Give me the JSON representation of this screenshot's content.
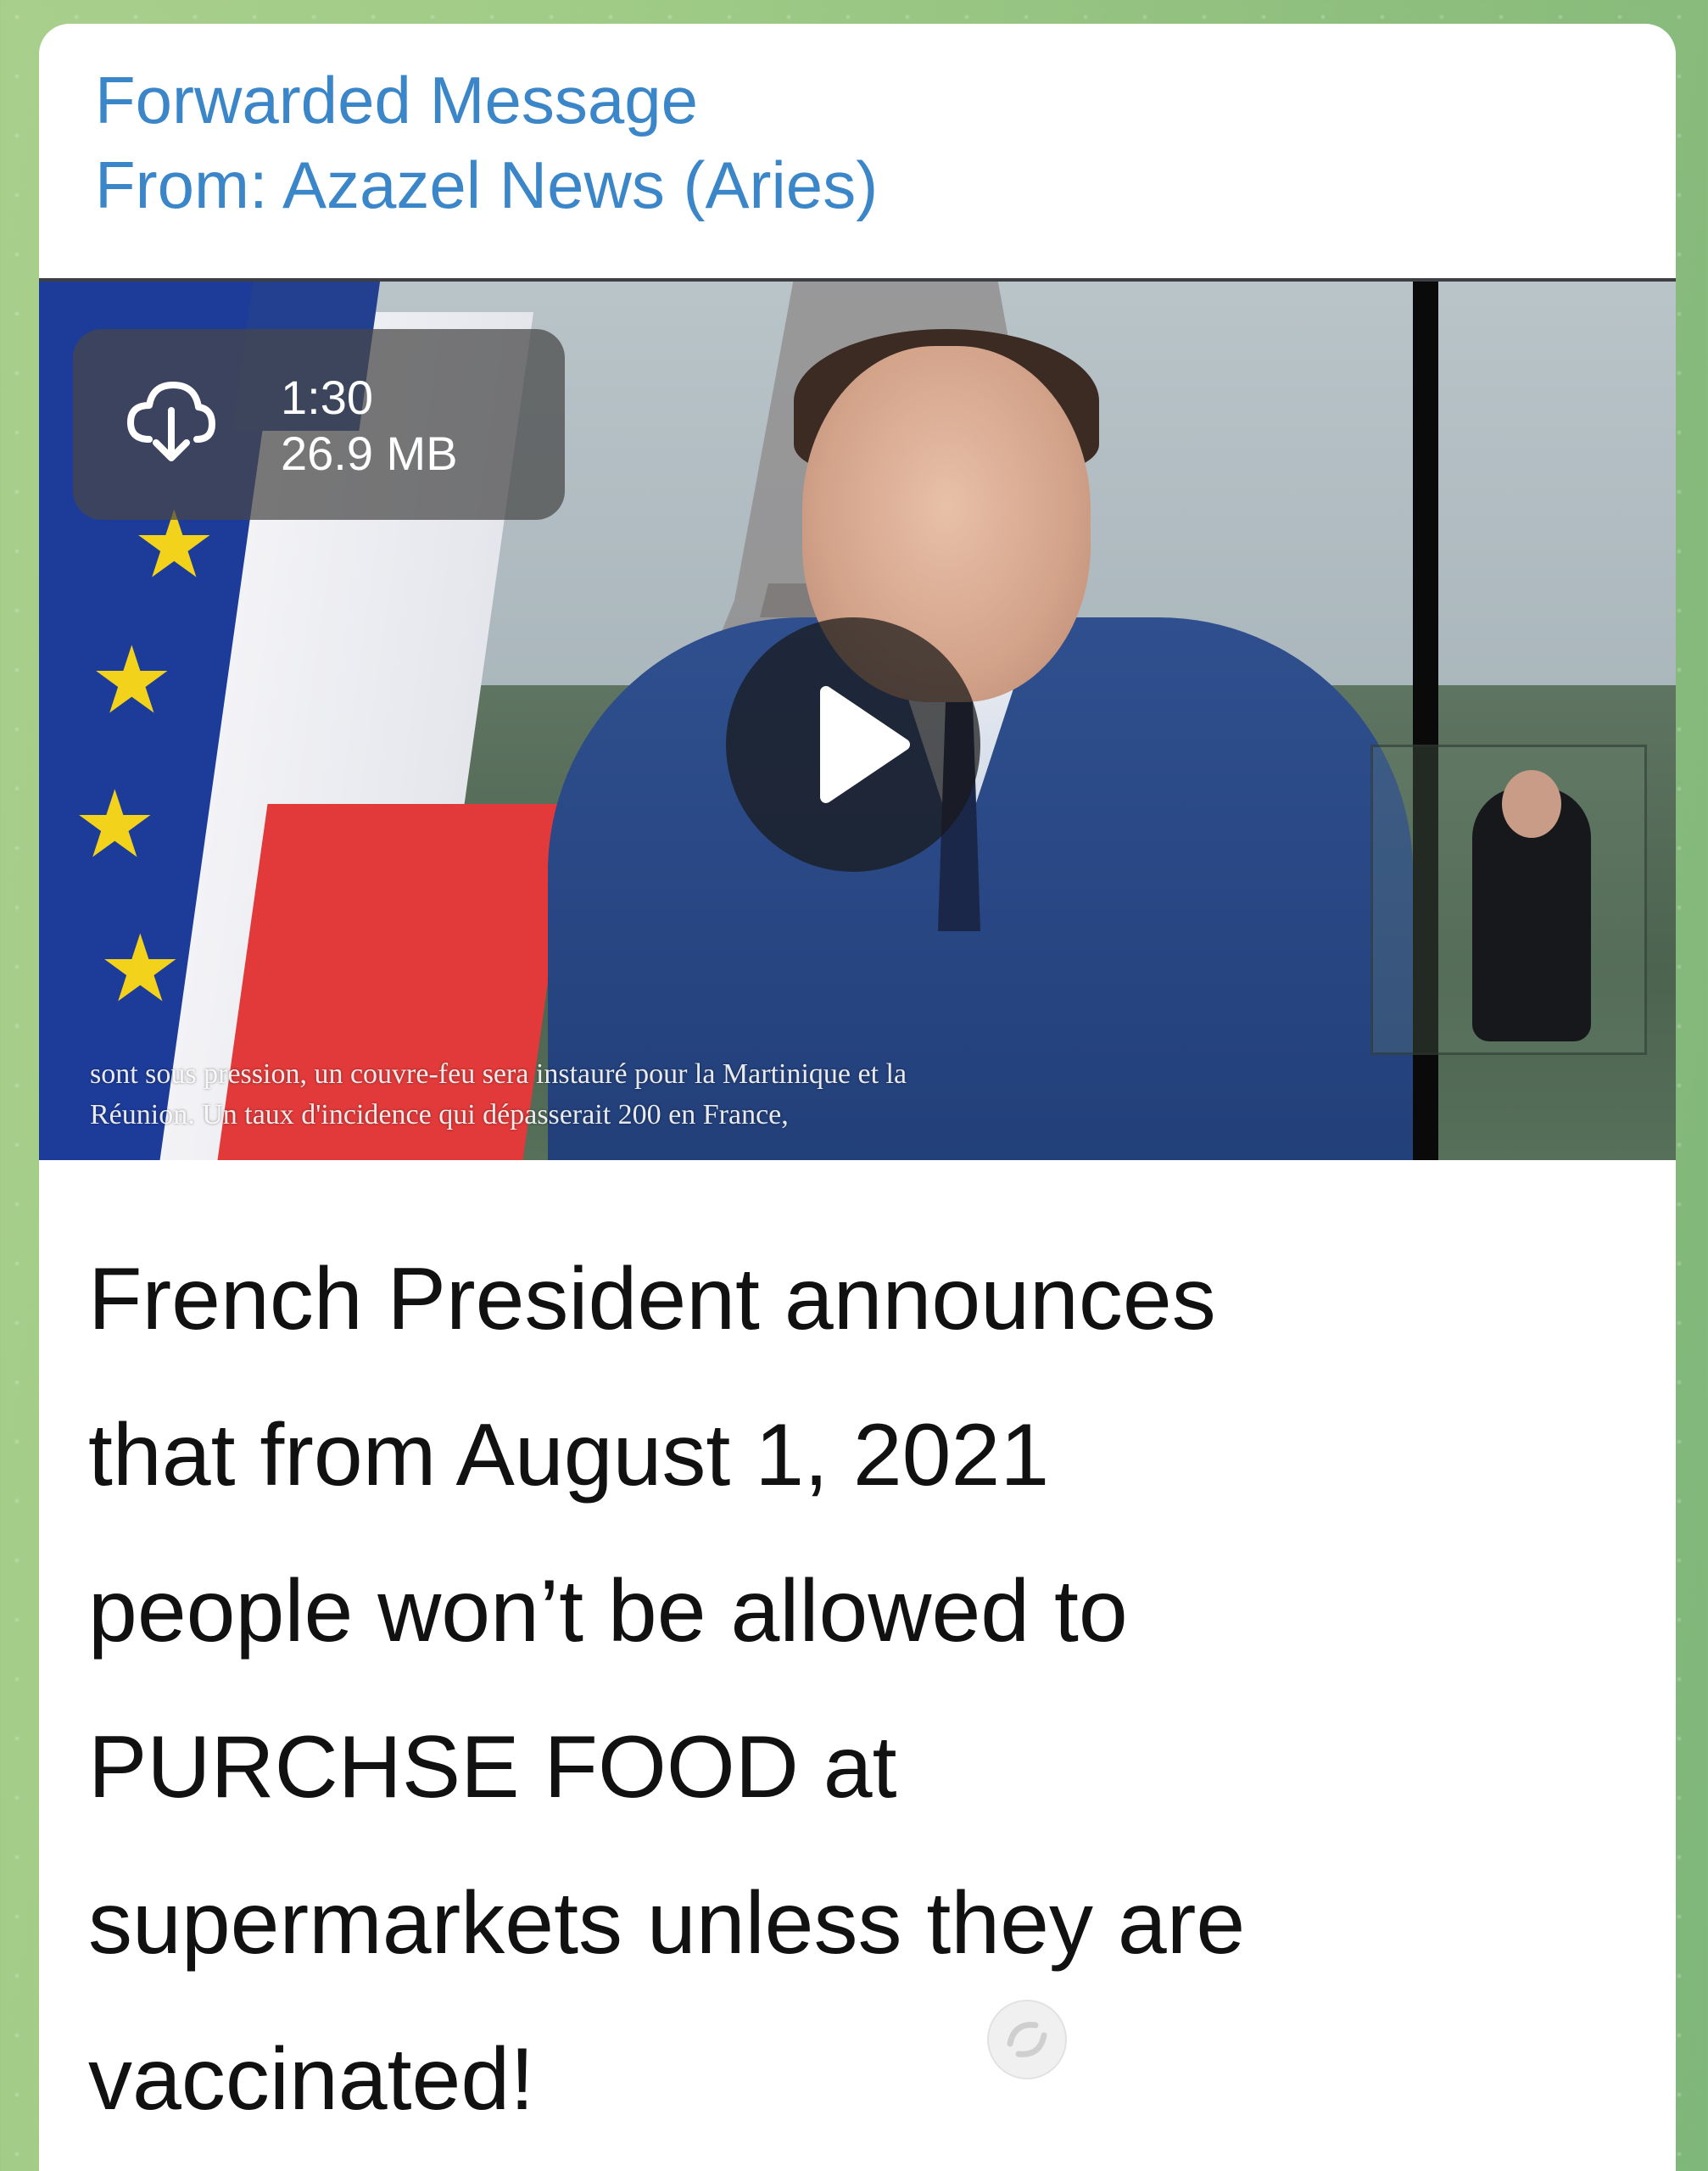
{
  "message": {
    "forwarded_label": "Forwarded Message",
    "from_line": "From: Azazel News (Aries)"
  },
  "video": {
    "duration": "1:30",
    "file_size": "26.9 MB",
    "download_icon": "cloud-download-icon",
    "play_icon": "play-icon",
    "subtitle_lines": [
      "sont sous pression, un couvre-feu sera instauré pour la Martinique et la",
      "Réunion. Un taux d'incidence qui dépasserait 200 en France,"
    ]
  },
  "caption": {
    "lines": [
      "French President announces",
      "that from August 1, 2021",
      "people won’t be allowed to",
      "PURCHSE FOOD at",
      "supermarkets unless they are",
      "vaccinated!"
    ]
  },
  "colors": {
    "header_blue": "#3a86c8",
    "bubble_background": "#ffffff",
    "wallpaper_green": "#9fcb86",
    "caption_text": "#111111"
  }
}
